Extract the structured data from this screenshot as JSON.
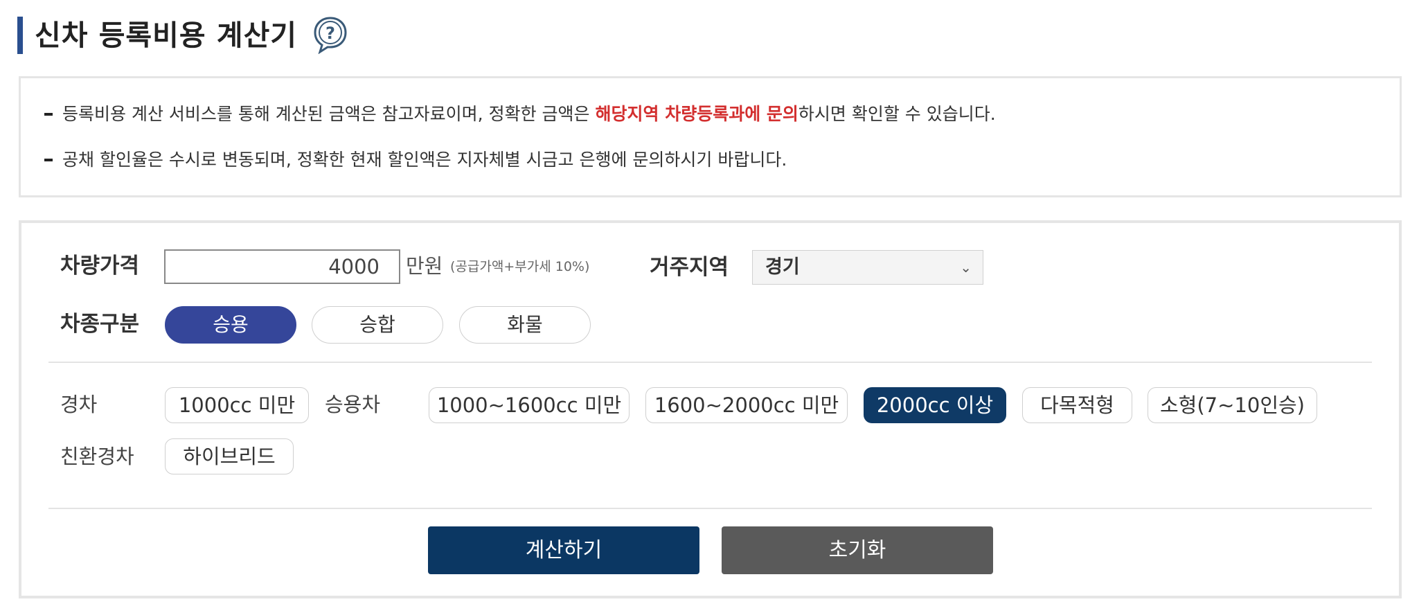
{
  "title": "신차 등록비용 계산기",
  "notices": [
    {
      "before": "등록비용 계산 서비스를 통해 계산된 금액은 참고자료이며, 정확한 금액은 ",
      "highlight": "해당지역 차량등록과에 문의",
      "after": "하시면 확인할 수 있습니다."
    },
    {
      "before": "공채 할인율은 수시로 변동되며, 정확한 현재 할인액은 지자체별 시금고 은행에 문의하시기 바랍니다.",
      "highlight": "",
      "after": ""
    }
  ],
  "form": {
    "price_label": "차량가격",
    "price_value": "4000",
    "price_unit": "만원",
    "price_note": "(공급가액+부가세 10%)",
    "region_label": "거주지역",
    "region_value": "경기",
    "type_label": "차종구분",
    "types": [
      {
        "label": "승용",
        "active": true
      },
      {
        "label": "승합",
        "active": false
      },
      {
        "label": "화물",
        "active": false
      }
    ],
    "categories": {
      "light_label": "경차",
      "light_options": [
        "1000cc 미만"
      ],
      "passenger_label": "승용차",
      "passenger_options": [
        "1000~1600cc 미만",
        "1600~2000cc 미만",
        "2000cc 이상",
        "다목적형",
        "소형(7~10인승)"
      ],
      "passenger_active": "2000cc 이상",
      "eco_label": "친환경차",
      "eco_options": [
        "하이브리드"
      ]
    }
  },
  "buttons": {
    "calculate": "계산하기",
    "reset": "초기화"
  },
  "colors": {
    "accent": "#2a4f8f",
    "highlight": "#d32f2f",
    "type_active": "#35469a",
    "chip_active": "#0f3a66",
    "calc_button": "#0b3763",
    "reset_button": "#5a5a5a"
  },
  "icons": {
    "help": "question-speech-icon",
    "select": "chevron-down-icon"
  }
}
